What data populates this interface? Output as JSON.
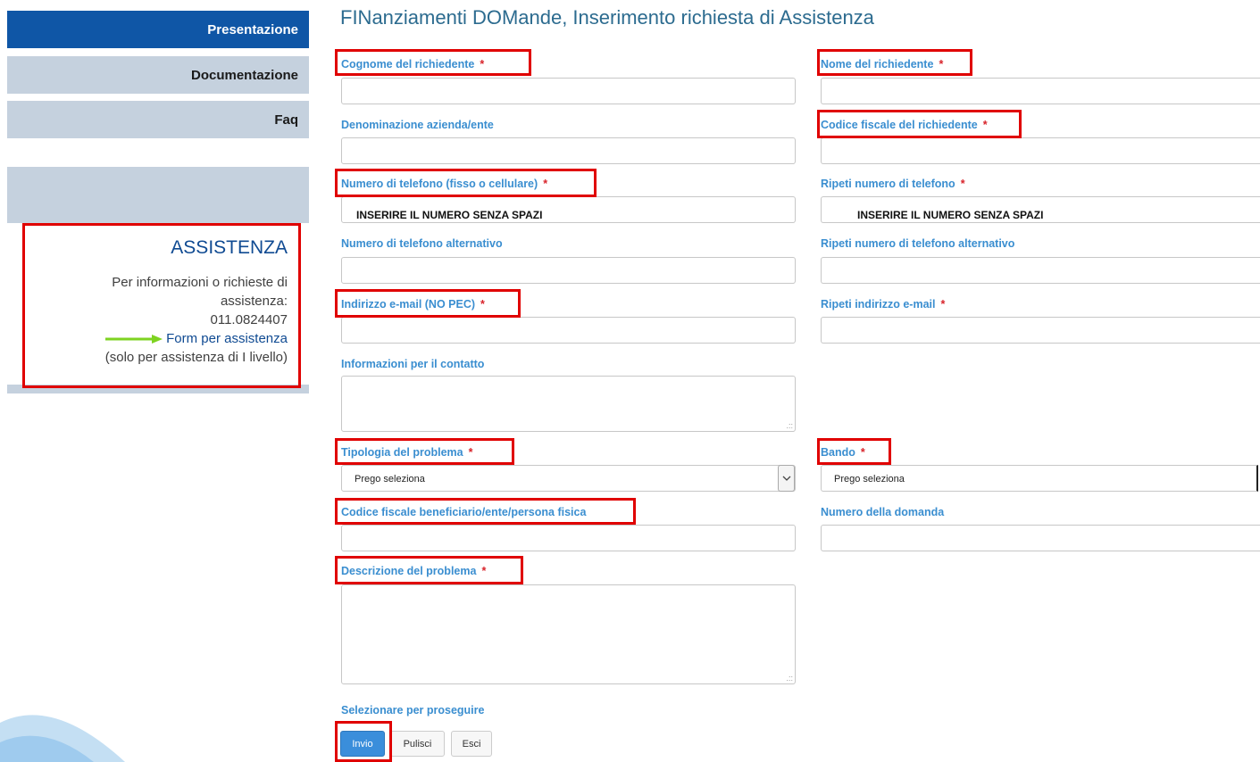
{
  "sidebar": {
    "nav": [
      "Presentazione",
      "Documentazione",
      "Faq"
    ],
    "assist": {
      "title": "ASSISTENZA",
      "line1": "Per informazioni o richieste di",
      "line2": "assistenza:",
      "phone": "011.0824407",
      "link": "Form per assistenza",
      "note": "(solo per assistenza di I livello)"
    }
  },
  "form": {
    "title": "FINanziamenti DOMande, Inserimento richiesta di Assistenza",
    "required_marker": "*",
    "labels": {
      "cognome": "Cognome del richiedente",
      "nome": "Nome del richiedente",
      "denominazione": "Denominazione azienda/ente",
      "codice_fiscale": "Codice fiscale del richiedente",
      "telefono": "Numero di telefono (fisso o cellulare)",
      "ripeti_telefono": "Ripeti numero di telefono",
      "telefono_alt": "Numero di telefono alternativo",
      "ripeti_telefono_alt": "Ripeti numero di telefono alternativo",
      "email": "Indirizzo e-mail (NO PEC)",
      "ripeti_email": "Ripeti indirizzo e-mail",
      "info_contatto": "Informazioni per il contatto",
      "tipologia": "Tipologia del problema",
      "bando": "Bando",
      "cf_beneficiario": "Codice fiscale beneficiario/ente/persona fisica",
      "numero_domanda": "Numero della domanda",
      "descrizione": "Descrizione del problema",
      "selezionare": "Selezionare per proseguire"
    },
    "values": {
      "telefono": "INSERIRE IL NUMERO SENZA SPAZI",
      "ripeti_telefono": "INSERIRE IL NUMERO SENZA SPAZI"
    },
    "selects": {
      "tipologia": "Prego seleziona",
      "bando": "Prego seleziona"
    },
    "buttons": {
      "invio": "Invio",
      "pulisci": "Pulisci",
      "esci": "Esci"
    }
  },
  "colors": {
    "nav_active": "#0f56a6",
    "nav_inactive": "#c5d1de",
    "label_blue": "#3a8ed0",
    "title_blue": "#2c6b8f",
    "highlight_red": "#e00000",
    "arrow_green": "#7ed321"
  }
}
